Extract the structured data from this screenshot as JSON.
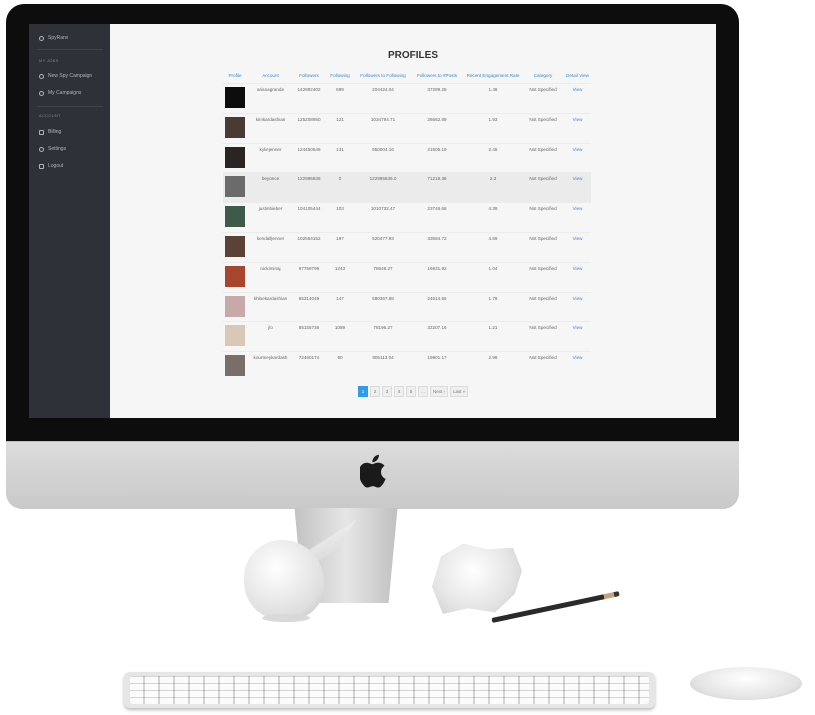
{
  "sidebar": {
    "brand": "SpyRanx",
    "section_jobs": "MY JOBS",
    "new_spy_campaign": "New Spy Campaign",
    "my_campaigns": "My Campaigns",
    "section_account": "ACCOUNT",
    "billing": "Billing",
    "settings": "Settings",
    "logout": "Logout"
  },
  "page": {
    "title": "PROFILES"
  },
  "table": {
    "headers": [
      "Profile",
      "Account",
      "Followers",
      "Following",
      "Followers to Following",
      "Followers to #Posts",
      "Recent Engagement Rate",
      "Category",
      "Detail View"
    ],
    "rows": [
      {
        "account": "arianagrande",
        "followers": "142892402",
        "following": "699",
        "f2f": "204424.04",
        "f2p": "37289.25",
        "rate": "1.48",
        "category": "Not Specified",
        "view": "View",
        "thumb": "#0d0d0d"
      },
      {
        "account": "kimkardashian",
        "followers": "125208950",
        "following": "121",
        "f2f": "1034784.71",
        "f2p": "26662.89",
        "rate": "1.93",
        "category": "Not Specified",
        "view": "View",
        "thumb": "#4a3a34"
      },
      {
        "account": "kyliejenner",
        "followers": "124450545",
        "following": "131",
        "f2f": "950004.16",
        "f2p": "21505.19",
        "rate": "2.45",
        "category": "Not Specified",
        "view": "View",
        "thumb": "#2a2522"
      },
      {
        "account": "beyonce",
        "followers": "122995835",
        "following": "0",
        "f2f": "122995835.0",
        "f2p": "71219.36",
        "rate": "2.3",
        "category": "Not Specified",
        "view": "View",
        "thumb": "#6b6b6b"
      },
      {
        "account": "justinbieber",
        "followers": "104105444",
        "following": "103",
        "f2f": "1010732.47",
        "f2p": "23746.68",
        "rate": "4.39",
        "category": "Not Specified",
        "view": "View",
        "thumb": "#3d5a4a"
      },
      {
        "account": "kendalljenner",
        "followers": "102554152",
        "following": "197",
        "f2f": "520477.93",
        "f2p": "33584.72",
        "rate": "4.69",
        "category": "Not Specified",
        "view": "View",
        "thumb": "#5a4236"
      },
      {
        "account": "nickiminaj",
        "followers": "97759799",
        "following": "1243",
        "f2f": "78648.27",
        "f2p": "16831.92",
        "rate": "1.04",
        "category": "Not Specified",
        "view": "View",
        "thumb": "#a8452e"
      },
      {
        "account": "khloekardashian",
        "followers": "85314049",
        "following": "147",
        "f2f": "580367.68",
        "f2p": "24614.56",
        "rate": "1.78",
        "category": "Not Specified",
        "view": "View",
        "thumb": "#c7a9a9"
      },
      {
        "account": "jlo",
        "followers": "85155736",
        "following": "1089",
        "f2f": "78196.27",
        "f2p": "32207.16",
        "rate": "1.21",
        "category": "Not Specified",
        "view": "View",
        "thumb": "#d9c8b8"
      },
      {
        "account": "kourtneykardash",
        "followers": "72460174",
        "following": "90",
        "f2f": "805113.04",
        "f2p": "19901.17",
        "rate": "2.98",
        "category": "Not Specified",
        "view": "View",
        "thumb": "#7a6e6a"
      }
    ]
  },
  "pagination": {
    "pages": [
      "1",
      "2",
      "3",
      "4",
      "5",
      "..."
    ],
    "next": "Next ›",
    "last": "Last »",
    "active": "1"
  }
}
